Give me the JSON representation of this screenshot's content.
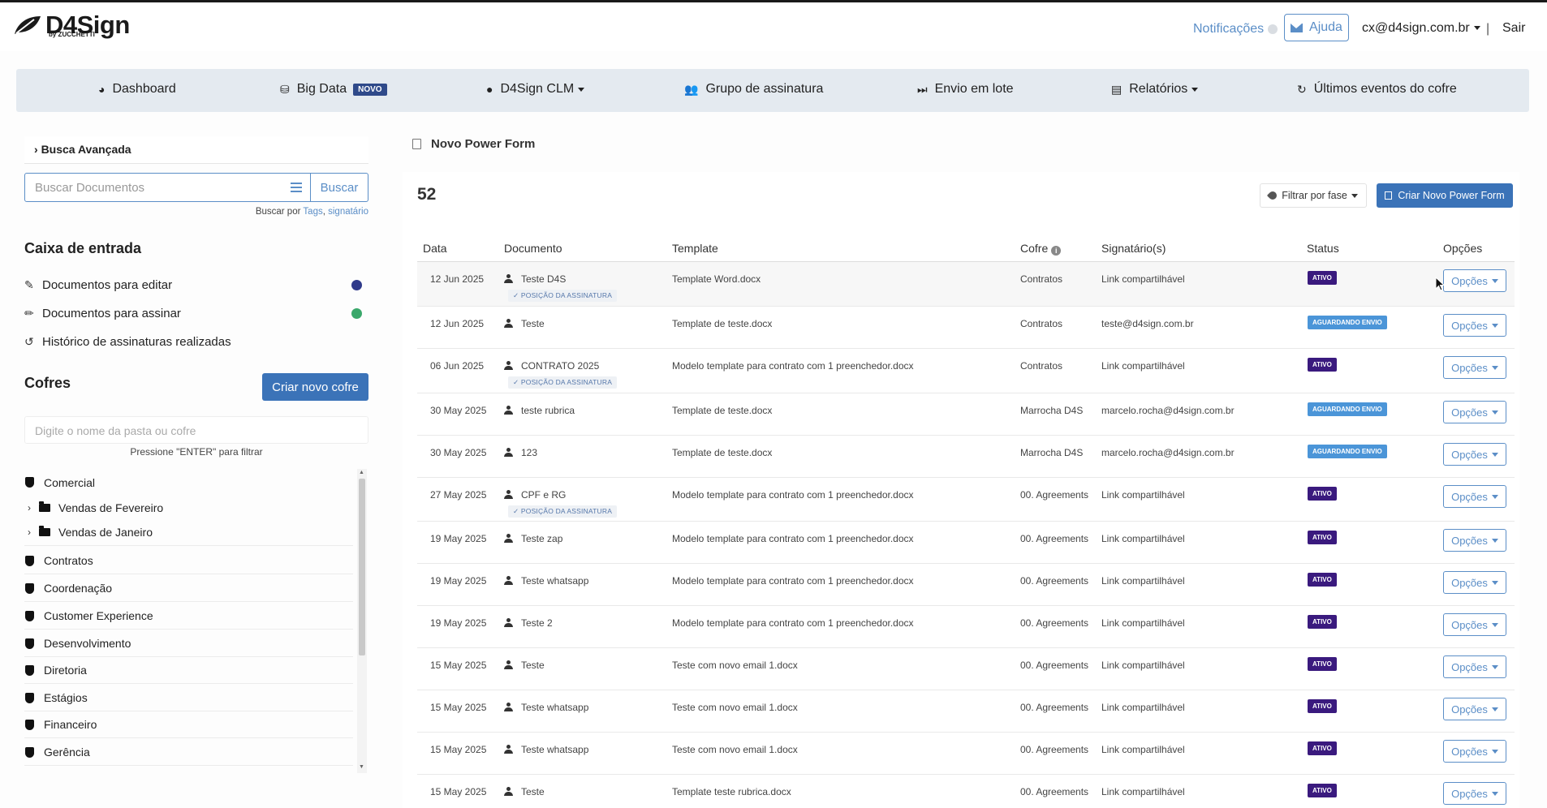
{
  "brand": {
    "name": "D4Sign",
    "sub": "by ZUCCHETTI"
  },
  "header": {
    "notifications": "Notificações",
    "help": "Ajuda",
    "user": "cx@d4sign.com.br",
    "separator": "|",
    "logout": "Sair"
  },
  "nav": [
    {
      "label": "Dashboard",
      "icon": "dashboard-icon"
    },
    {
      "label": "Big Data",
      "icon": "database-icon",
      "badge": "NOVO"
    },
    {
      "label": "D4Sign CLM",
      "icon": "clm-icon"
    },
    {
      "label": "Grupo de assinatura",
      "icon": "users-icon"
    },
    {
      "label": "Envio em lote",
      "icon": "fast-forward-icon"
    },
    {
      "label": "Relatórios",
      "icon": "report-icon"
    },
    {
      "label": "Últimos eventos do cofre",
      "icon": "refresh-icon"
    }
  ],
  "sidebar": {
    "advanced_search": "Busca Avançada",
    "search_placeholder": "Buscar Documentos",
    "search_button": "Buscar",
    "search_hint_prefix": "Buscar por",
    "search_hint_tags": "Tags",
    "search_hint_sep": ",",
    "search_hint_signer": "signatário",
    "inbox_title": "Caixa de entrada",
    "inbox": [
      {
        "label": "Documentos para editar",
        "indicator_color": "#2f3a8a"
      },
      {
        "label": "Documentos para assinar",
        "indicator_color": "#3aa86b"
      },
      {
        "label": "Histórico de assinaturas realizadas"
      }
    ],
    "vaults_title": "Cofres",
    "new_vault": "Criar novo cofre",
    "folder_filter_placeholder": "Digite o nome da pasta ou cofre",
    "folder_filter_hint": "Pressione \"ENTER\" para filtrar",
    "vaults": [
      {
        "label": "Comercial",
        "type": "vault"
      },
      {
        "label": "Vendas de Fevereiro",
        "type": "folder"
      },
      {
        "label": "Vendas de Janeiro",
        "type": "folder"
      },
      {
        "label": "Contratos",
        "type": "vault"
      },
      {
        "label": "Coordenação",
        "type": "vault"
      },
      {
        "label": "Customer Experience",
        "type": "vault"
      },
      {
        "label": "Desenvolvimento",
        "type": "vault"
      },
      {
        "label": "Diretoria",
        "type": "vault"
      },
      {
        "label": "Estágios",
        "type": "vault"
      },
      {
        "label": "Financeiro",
        "type": "vault"
      },
      {
        "label": "Gerência",
        "type": "vault"
      }
    ]
  },
  "main": {
    "title": "Novo Power Form",
    "count": "52",
    "filter_phase": "Filtrar por fase",
    "new_powerform": "Criar Novo Power Form",
    "columns": [
      "Data",
      "Documento",
      "Template",
      "Cofre",
      "Signatário(s)",
      "Status",
      "Opções"
    ],
    "options_label": "Opções",
    "rows": [
      {
        "date": "12 Jun 2025",
        "doc": "Teste D4S",
        "tag": "✓ POSIÇÃO DA ASSINATURA",
        "template": "Template Word.docx",
        "vault": "Contratos",
        "signer": "Link compartilhável",
        "status": "ATIVO"
      },
      {
        "date": "12 Jun 2025",
        "doc": "Teste",
        "tag": "",
        "template": "Template de teste.docx",
        "vault": "Contratos",
        "signer": "teste@d4sign.com.br",
        "status": "AGUARDANDO ENVIO"
      },
      {
        "date": "06 Jun 2025",
        "doc": "CONTRATO 2025",
        "tag": "✓ POSIÇÃO DA ASSINATURA",
        "template": "Modelo template para contrato com 1 preenchedor.docx",
        "vault": "Contratos",
        "signer": "Link compartilhável",
        "status": "ATIVO"
      },
      {
        "date": "30 May 2025",
        "doc": "teste rubrica",
        "tag": "",
        "template": "Template de teste.docx",
        "vault": "Marrocha D4S",
        "signer": "marcelo.rocha@d4sign.com.br",
        "status": "AGUARDANDO ENVIO"
      },
      {
        "date": "30 May 2025",
        "doc": "123",
        "tag": "",
        "template": "Template de teste.docx",
        "vault": "Marrocha D4S",
        "signer": "marcelo.rocha@d4sign.com.br",
        "status": "AGUARDANDO ENVIO"
      },
      {
        "date": "27 May 2025",
        "doc": "CPF e RG",
        "tag": "✓ POSIÇÃO DA ASSINATURA",
        "template": "Modelo template para contrato com 1 preenchedor.docx",
        "vault": "00. Agreements",
        "signer": "Link compartilhável",
        "status": "ATIVO"
      },
      {
        "date": "19 May 2025",
        "doc": "Teste zap",
        "tag": "",
        "template": "Modelo template para contrato com 1 preenchedor.docx",
        "vault": "00. Agreements",
        "signer": "Link compartilhável",
        "status": "ATIVO"
      },
      {
        "date": "19 May 2025",
        "doc": "Teste whatsapp",
        "tag": "",
        "template": "Modelo template para contrato com 1 preenchedor.docx",
        "vault": "00. Agreements",
        "signer": "Link compartilhável",
        "status": "ATIVO"
      },
      {
        "date": "19 May 2025",
        "doc": "Teste 2",
        "tag": "",
        "template": "Modelo template para contrato com 1 preenchedor.docx",
        "vault": "00. Agreements",
        "signer": "Link compartilhável",
        "status": "ATIVO"
      },
      {
        "date": "15 May 2025",
        "doc": "Teste",
        "tag": "",
        "template": "Teste com novo email 1.docx",
        "vault": "00. Agreements",
        "signer": "Link compartilhável",
        "status": "ATIVO"
      },
      {
        "date": "15 May 2025",
        "doc": "Teste whatsapp",
        "tag": "",
        "template": "Teste com novo email 1.docx",
        "vault": "00. Agreements",
        "signer": "Link compartilhável",
        "status": "ATIVO"
      },
      {
        "date": "15 May 2025",
        "doc": "Teste whatsapp",
        "tag": "",
        "template": "Teste com novo email 1.docx",
        "vault": "00. Agreements",
        "signer": "Link compartilhável",
        "status": "ATIVO"
      },
      {
        "date": "15 May 2025",
        "doc": "Teste",
        "tag": "",
        "template": "Template teste rubrica.docx",
        "vault": "00. Agreements",
        "signer": "Link compartilhável",
        "status": "ATIVO"
      }
    ]
  },
  "colors": {
    "accent": "#3b73b8",
    "link": "#5b8ec7",
    "status_active": "#3a1a7e",
    "status_waiting": "#4b95d8",
    "nav_bg": "#e4eaf0"
  }
}
